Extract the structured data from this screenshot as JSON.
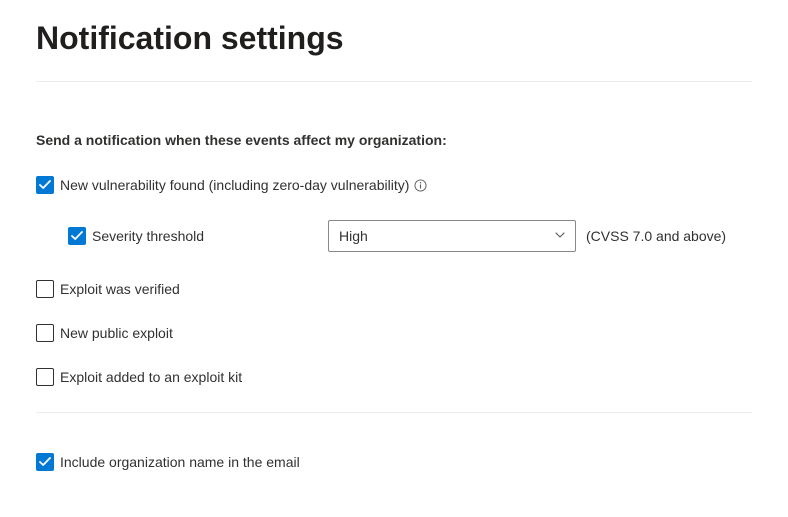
{
  "page": {
    "title": "Notification settings",
    "section_label": "Send a notification when these events affect my organization:"
  },
  "options": {
    "new_vulnerability": {
      "label": "New vulnerability found (including zero-day vulnerability)",
      "checked": true
    },
    "severity_threshold": {
      "label": "Severity threshold",
      "checked": true,
      "select_value": "High",
      "hint": "(CVSS 7.0 and above)"
    },
    "exploit_verified": {
      "label": "Exploit was verified",
      "checked": false
    },
    "new_public_exploit": {
      "label": "New public exploit",
      "checked": false
    },
    "exploit_kit": {
      "label": "Exploit added to an exploit kit",
      "checked": false
    },
    "include_org_name": {
      "label": "Include organization name in the email",
      "checked": true
    }
  }
}
